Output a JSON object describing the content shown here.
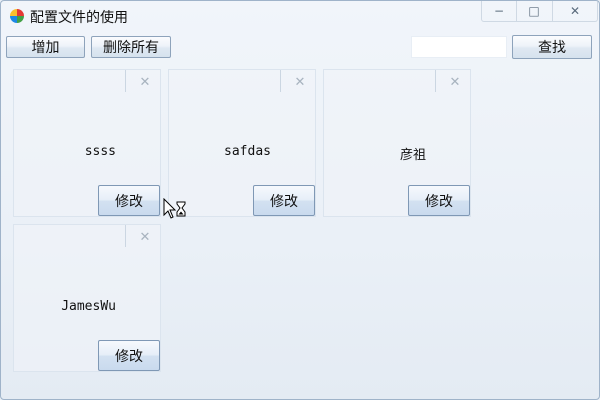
{
  "window": {
    "title": "配置文件的使用",
    "minimize_glyph": "−",
    "maximize_glyph": "□",
    "close_glyph": "✕"
  },
  "toolbar": {
    "add_label": "增加",
    "delete_all_label": "删除所有",
    "search_value": "",
    "search_label": "查找"
  },
  "cards": [
    {
      "name": "ssss",
      "edit_label": "修改",
      "close_glyph": "✕"
    },
    {
      "name": "safdas",
      "edit_label": "修改",
      "close_glyph": "✕"
    },
    {
      "name": "彦祖",
      "edit_label": "修改",
      "close_glyph": "✕"
    },
    {
      "name": "JamesWu",
      "edit_label": "修改",
      "close_glyph": "✕"
    }
  ],
  "cursor_icon": "arrow-busy-icon"
}
